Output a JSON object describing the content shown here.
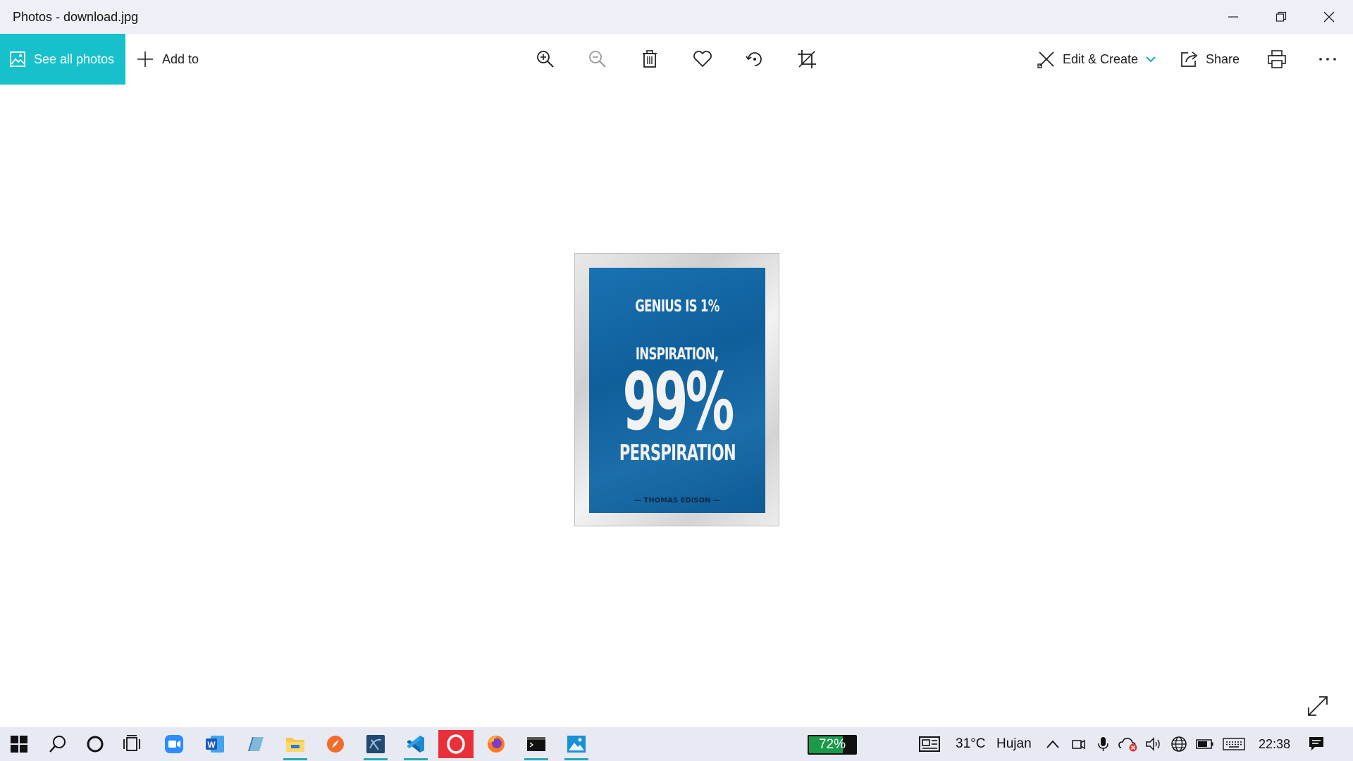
{
  "window": {
    "title": "Photos - download.jpg"
  },
  "toolbar": {
    "see_all_photos": "See all photos",
    "add_to": "Add to",
    "edit_create": "Edit & Create",
    "share": "Share",
    "more": "..."
  },
  "photo": {
    "line1": "GENIUS IS 1%",
    "line1a": "INSPIRATION,",
    "big": "99%",
    "line3": "PERSPIRATION",
    "author": "— THOMAS EDISON —"
  },
  "taskbar": {
    "battery_percent": "72%",
    "battery_level": 0.72,
    "temperature": "31°C",
    "weather": "Hujan",
    "clock": "22:38"
  },
  "colors": {
    "accent": "#16c1cc",
    "poster_blue": "#1467a6"
  }
}
